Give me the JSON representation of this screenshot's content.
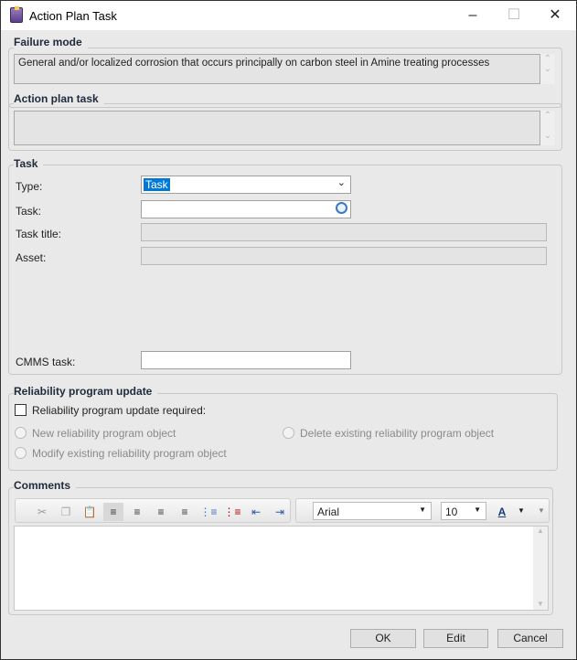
{
  "window": {
    "title": "Action Plan Task"
  },
  "failure_mode": {
    "label": "Failure mode",
    "text": "General and/or localized corrosion that occurs principally on carbon steel in Amine treating processes"
  },
  "action_plan_task": {
    "label": "Action plan task",
    "text": ""
  },
  "task": {
    "label": "Task",
    "type_label": "Type:",
    "type_value": "Task",
    "task_label": "Task:",
    "task_value": "",
    "task_title_label": "Task title:",
    "asset_label": "Asset:",
    "cmms_label": "CMMS task:",
    "cmms_value": ""
  },
  "reliability": {
    "label": "Reliability program update",
    "checkbox_label": "Reliability program update required:",
    "checked": false,
    "radio_new": "New reliability program object",
    "radio_delete": "Delete existing reliability program object",
    "radio_modify": "Modify existing reliability program object"
  },
  "comments": {
    "label": "Comments",
    "font": "Arial",
    "size": "10",
    "text": ""
  },
  "buttons": {
    "ok": "OK",
    "edit": "Edit",
    "cancel": "Cancel"
  },
  "colors": {
    "selection": "#0078d7"
  }
}
